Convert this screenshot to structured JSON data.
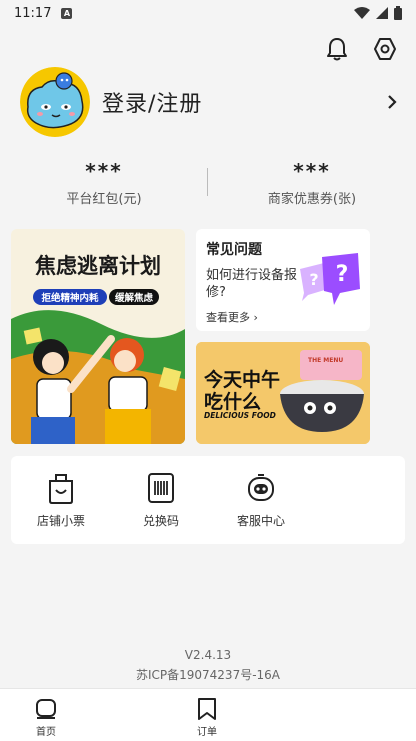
{
  "status_bar": {
    "time": "11:17",
    "sim_badge": "A"
  },
  "header": {
    "icons": [
      "bell-icon",
      "settings-icon"
    ]
  },
  "profile": {
    "login_label": "登录/注册"
  },
  "stats": [
    {
      "value": "***",
      "label": "平台红包(元)"
    },
    {
      "value": "***",
      "label": "商家优惠券(张)"
    }
  ],
  "banner_anxiety": {
    "title": "焦虑逃离计划",
    "tag1": "拒绝精神内耗",
    "tag2": "缓解焦虑"
  },
  "faq": {
    "title": "常见问题",
    "question": "如何进行设备报修?",
    "more": "查看更多"
  },
  "banner_food": {
    "title_line1": "今天中午",
    "title_line2": "吃什么",
    "subtitle": "DELICIOUS FOOD",
    "menu_label": "THE MENU"
  },
  "tools": [
    {
      "label": "店铺小票",
      "icon": "receipt-bag-icon"
    },
    {
      "label": "兑换码",
      "icon": "barcode-icon"
    },
    {
      "label": "客服中心",
      "icon": "robot-service-icon"
    }
  ],
  "footer": {
    "version": "V2.4.13",
    "icp": "苏ICP备19074237号-16A"
  },
  "tabbar": [
    {
      "label": "首页",
      "icon": "home-icon"
    },
    {
      "label": "订单",
      "icon": "bookmark-icon"
    }
  ],
  "colors": {
    "background": "#f4f4f4",
    "card": "#ffffff",
    "accent_purple": "#9b4dff",
    "banner_green": "#3a9a3a",
    "banner_food": "#f4c86a"
  }
}
